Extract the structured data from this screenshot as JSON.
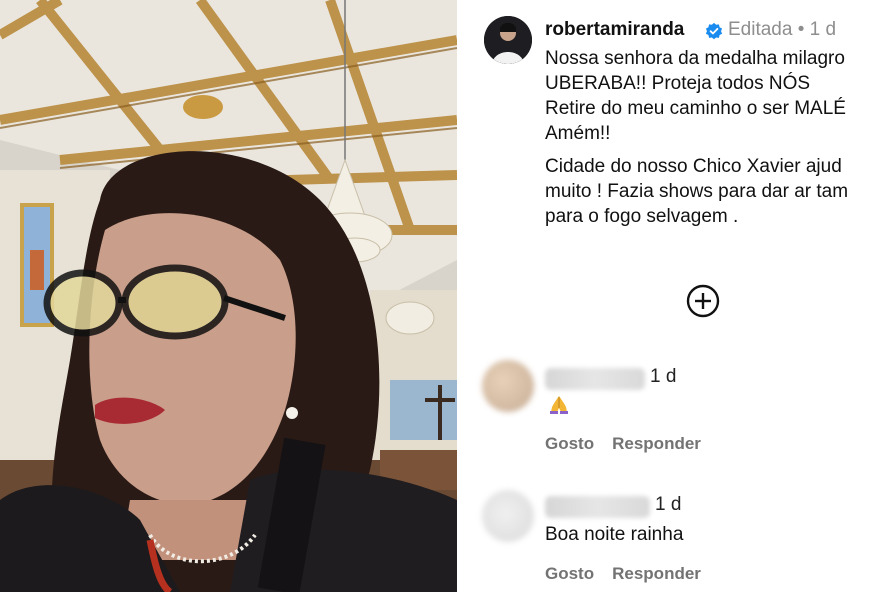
{
  "post": {
    "username": "robertamiranda",
    "verified_icon": "verified-badge-icon",
    "edited_label": "Editada",
    "separator": "•",
    "time": "1 d",
    "caption_lines": [
      "Nossa senhora da medalha milagro",
      "UBERABA!! Proteja todos NÓS",
      "Retire do meu caminho o ser MALÉ",
      "Amém!!",
      "Cidade do nosso Chico Xavier  ajud",
      "muito ! Fazia shows para dar ar tam",
      "para o fogo selvagem ."
    ],
    "more_icon": "plus-circle-icon"
  },
  "comments": [
    {
      "time": "1 d",
      "text": "",
      "emoji_icon": "folded-hands-icon",
      "like_label": "Gosto",
      "reply_label": "Responder"
    },
    {
      "time": "1 d",
      "text": "Boa noite rainha",
      "like_label": "Gosto",
      "reply_label": "Responder"
    }
  ],
  "colors": {
    "verified_blue": "#1a8cf0",
    "muted_text": "#8e8e8e",
    "action_text": "#737373"
  }
}
